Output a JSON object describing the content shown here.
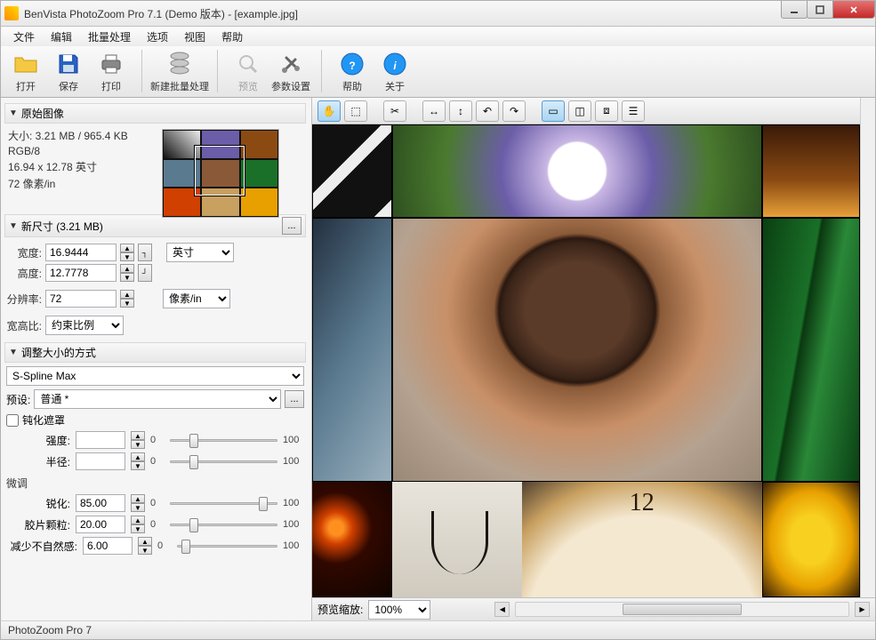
{
  "window": {
    "title": "BenVista PhotoZoom Pro 7.1 (Demo 版本) - [example.jpg]"
  },
  "menubar": {
    "file": "文件",
    "edit": "编辑",
    "batch": "批量处理",
    "options": "选项",
    "view": "视图",
    "help": "帮助"
  },
  "toolbar": {
    "open": "打开",
    "save": "保存",
    "print": "打印",
    "new_batch": "新建批量处理",
    "preview": "预览",
    "params": "参数设置",
    "help": "帮助",
    "about": "关于"
  },
  "original": {
    "header": "原始图像",
    "size_line": "大小: 3.21 MB / 965.4 KB",
    "mode": "RGB/8",
    "dim": "16.94 x 12.78 英寸",
    "res": "72 像素/in"
  },
  "newsize": {
    "header": "新尺寸 (3.21 MB)",
    "width_lbl": "宽度:",
    "width_val": "16.9444",
    "height_lbl": "高度:",
    "height_val": "12.7778",
    "unit": "英寸",
    "res_lbl": "分辨率:",
    "res_val": "72",
    "res_unit": "像素/in",
    "aspect_lbl": "宽高比:",
    "aspect_val": "约束比例"
  },
  "resize": {
    "header": "调整大小的方式",
    "method": "S-Spline Max",
    "preset_lbl": "预设:",
    "preset_val": "普通 *",
    "usm_cb": "钝化遮罩",
    "strength_lbl": "强度:",
    "radius_lbl": "半径:",
    "fine_header": "微调",
    "sharpen_lbl": "锐化:",
    "sharpen_val": "85.00",
    "grain_lbl": "胶片颗粒:",
    "grain_val": "20.00",
    "artifact_lbl": "减少不自然感:",
    "artifact_val": "6.00",
    "min": "0",
    "max": "100"
  },
  "preview_bar": {
    "zoom_lbl": "预览缩放:",
    "zoom_val": "100%"
  },
  "status": {
    "text": "PhotoZoom Pro 7"
  }
}
